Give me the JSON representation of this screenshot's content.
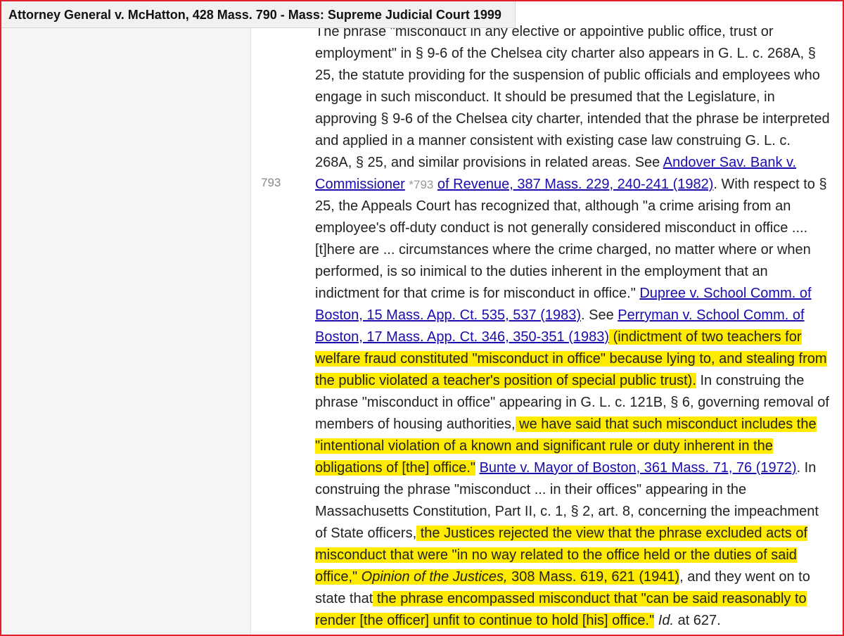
{
  "header": {
    "title": "Attorney General v. McHatton, 428 Mass. 790 - Mass: Supreme Judicial Court 1999"
  },
  "page_marker": "793",
  "star_marker": "*793",
  "colors": {
    "highlight": "#ffeb00",
    "link": "#1a0dab",
    "frame_border": "#e0202a"
  },
  "text": {
    "l1": "The phrase \"misconduct in any elective or appointive public office, trust or",
    "l2": "employment\" in § 9-6 of the Chelsea city charter also appears in G. L. c. 268A, §",
    "l3": "25, the statute providing for the suspension of public officials and employees who",
    "l4": "engage in such misconduct. It should be presumed that the Legislature, in",
    "l5": "approving § 9-6 of the Chelsea city charter, intended that the phrase be interpreted",
    "l6": "and applied in a manner consistent with existing case law construing G. L. c.",
    "l7": "268A, § 25, and similar provisions in related areas. See ",
    "l7_link": "Andover Sav. Bank v.",
    "l8_link_a": "Commissioner",
    "l8_link_b": "of Revenue, 387 Mass. 229, 240-241 (1982)",
    "l8_rest": ". With respect to §",
    "l9": "25, the Appeals Court has recognized that, although \"a crime arising from an",
    "l10": "employee's off-duty conduct is not generally considered misconduct in office ....",
    "l11": "[t]here are ... circumstances where the crime charged, no matter where or when",
    "l12": "performed, is so inimical to the duties inherent in the employment that an",
    "l13": "indictment for that crime is for misconduct in office.\" ",
    "l13_link": "Dupree v. School Comm. of",
    "l14_link": "Boston, 15 Mass. App. Ct. 535, 537 (1983)",
    "l14_rest": ". See ",
    "l14_link2": "Perryman v. School Comm. of",
    "l15_link": "Boston, 17 Mass. App. Ct. 346, 350-351 (1983)",
    "l15_hl": " (indictment of two teachers for",
    "l16_hl": "welfare fraud constituted \"misconduct in office\" because lying to, and stealing from",
    "l17_hl": "the public violated a teacher's position of special public trust).",
    "l17_rest": " In construing the",
    "l18": "phrase \"misconduct in office\" appearing in G. L. c. 121B, § 6, governing removal of",
    "l19": "members of housing authorities,",
    "l19_hl": " we have said that such misconduct includes the",
    "l20_hl": "\"intentional violation of a known and significant rule or duty inherent in the",
    "l21_hl": "obligations of [the] office.\"",
    "l21_link": "Bunte v. Mayor of Boston, 361 Mass. 71, 76 (1972)",
    "l21_rest": ". In",
    "l22": "construing the phrase \"misconduct ... in their offices\" appearing in the",
    "l23": "Massachusetts Constitution, Part II, c. 1, § 2, art. 8, concerning the impeachment",
    "l24": "of State officers,",
    "l24_hl": " the Justices rejected the view that the phrase excluded acts of",
    "l25_hl": "misconduct that were \"in no way related to the office held or the duties of said",
    "l26_hl": "office,\" ",
    "l26_hl_i": "Opinion of the Justices,",
    "l26_hl_b": " 308 Mass. 619, 621 (1941)",
    "l26_rest": ", and they went on to",
    "l27": "state that",
    "l27_hl": " the phrase encompassed misconduct that \"can be said reasonably to",
    "l28_hl": "render [the officer] unfit to continue to hold [his] office.\"",
    "l28_i": " Id.",
    "l28_rest": " at 627."
  }
}
